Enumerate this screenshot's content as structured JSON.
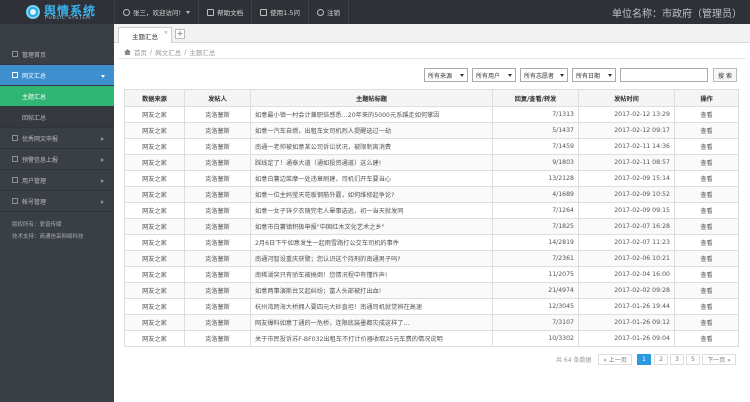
{
  "brand": {
    "title": "舆情系统",
    "subtitle": "PUBLIC SYSTEM"
  },
  "topnav": {
    "user": "张三，欢迎访问!",
    "help": "帮助文档",
    "tips": "使用1.5问",
    "logout": "注销"
  },
  "org": "单位名称：市政府（管理员）",
  "sidebar": {
    "items": [
      {
        "label": "管理首页"
      },
      {
        "label": "网文汇总"
      },
      {
        "label": "主题汇总"
      },
      {
        "label": "回帖汇总"
      },
      {
        "label": "优秀网文申报"
      },
      {
        "label": "预警信息上报"
      },
      {
        "label": "用户管理"
      },
      {
        "label": "帐号管理"
      }
    ],
    "footer": {
      "copyright": "版权所有：爱普传媒",
      "support": "技术支持：商通信采网络科技"
    }
  },
  "tabs": {
    "active": "主题汇总"
  },
  "breadcrumb": {
    "home": "首页",
    "sep1": "/",
    "level1": "网文汇总",
    "sep2": "/",
    "level2": "主题汇总"
  },
  "filters": {
    "source": "所有来源",
    "user": "所有用户",
    "status": "所有志愿者",
    "date": "所有日期",
    "search_button": "搜 索"
  },
  "table": {
    "headers": [
      "数据来源",
      "发帖人",
      "主题帖标题",
      "回复/查看/转发",
      "发帖时间",
      "操作"
    ],
    "rows": [
      [
        "网友之家",
        "克洛塞斯",
        "如意最小镇一村会计兼职倍感悉…20年来的5000元系蹊走如何掌因",
        "7/1313",
        "2017-02-12 13:29",
        "查看"
      ],
      [
        "网友之家",
        "克洛塞斯",
        "如意一汽车自燃，出租车女司机烈人提醒选过一劫",
        "5/1437",
        "2017-02-12 09:17",
        "查看"
      ],
      [
        "网友之家",
        "克洛塞斯",
        "南通一老帅被如意某公司诉讼状况，被限制离消费",
        "7/1459",
        "2017-02-11 14:36",
        "查看"
      ],
      [
        "网友之家",
        "克洛塞斯",
        "踩线定了！通泰大道（通如投资通道）这么建!",
        "9/1803",
        "2017-02-11 08:57",
        "查看"
      ],
      [
        "网友之家",
        "克洛塞斯",
        "如意白薯边菜摩一处违章刷建，司机们开车要当心",
        "13/2128",
        "2017-02-09 15:14",
        "查看"
      ],
      [
        "网友之家",
        "克洛塞斯",
        "如意一位主妈莹天花板钢筋外露，如何维修起争论?",
        "4/1689",
        "2017-02-09 10:52",
        "查看"
      ],
      [
        "网友之家",
        "克洛塞斯",
        "如意一女子锌夕衣随完老人晕事选逃，初一当天就发同",
        "7/1264",
        "2017-02-09 09:15",
        "查看"
      ],
      [
        "网友之家",
        "克洛塞斯",
        "如意市白薯镇积极申报\"中国红木文化艺术之乡\"",
        "7/1825",
        "2017-02-07 16:28",
        "查看"
      ],
      [
        "网友之家",
        "克洛塞斯",
        "2月6日下午如意发生一起雨雪路打公交车司机的事件",
        "14/2819",
        "2017-02-07 11:23",
        "查看"
      ],
      [
        "网友之家",
        "克洛塞斯",
        "南通河智设重庆获警；您认识这个持刑的南通男子吗?",
        "7/2361",
        "2017-02-06 10:21",
        "查看"
      ],
      [
        "网友之家",
        "克洛塞斯",
        "南稀湖突只有骄车被搞倒！您情况程中有懂炸声!",
        "11/2075",
        "2017-02-04 16:00",
        "查看"
      ],
      [
        "网友之家",
        "克洛塞斯",
        "如意两事演斯台又起纠纷；富人头部被打出血!",
        "21/4974",
        "2017-02-02 09:28",
        "查看"
      ],
      [
        "网友之家",
        "克洛塞斯",
        "杭州湾跨海大桥拥人要四元大砂直坦！南通司机就觉辨在高速",
        "12/3045",
        "2017-01-26 19:44",
        "查看"
      ],
      [
        "网友之家",
        "克洛塞斯",
        "网友爆料如意丁通的一危桥，连限底装墨都灾成这样了…",
        "7/3107",
        "2017-01-26 09:12",
        "查看"
      ],
      [
        "网友之家",
        "克洛塞斯",
        "关于市民投诉苏F-BF032出租车不打计价器收取25元车费的情况说明",
        "10/3302",
        "2017-01-26 09:04",
        "查看"
      ]
    ]
  },
  "pagination": {
    "total": "共 64 条数据",
    "prev": "« 上一页",
    "pages": [
      "1",
      "2",
      "3",
      "5"
    ],
    "ellipsis": "…",
    "next": "下一页 »",
    "current": "1"
  }
}
